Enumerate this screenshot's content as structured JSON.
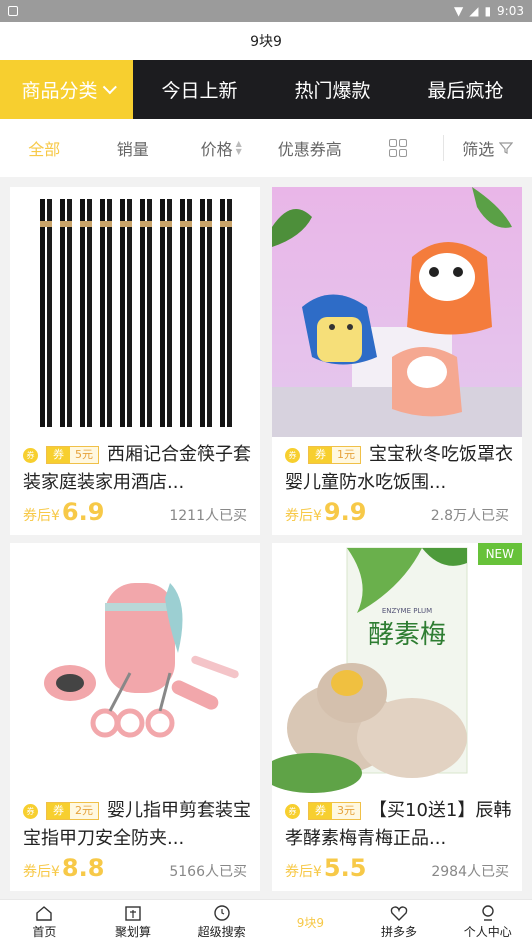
{
  "status": {
    "time": "9:03"
  },
  "header": {
    "title": "9块9"
  },
  "tabs": [
    {
      "label": "商品分类"
    },
    {
      "label": "今日上新"
    },
    {
      "label": "热门爆款"
    },
    {
      "label": "最后疯抢"
    }
  ],
  "sort": {
    "all": "全部",
    "sales": "销量",
    "price": "价格",
    "coupon": "优惠券高",
    "filter": "筛选"
  },
  "products": [
    {
      "coupon": "5元",
      "coupon_tag": "券",
      "title": "西厢记合金筷子套装家庭装家用酒店...",
      "price_label": "券后¥",
      "price": "6.9",
      "sold": "1211人已买"
    },
    {
      "coupon": "1元",
      "coupon_tag": "券",
      "title": "宝宝秋冬吃饭罩衣婴儿童防水吃饭围...",
      "price_label": "券后¥",
      "price": "9.9",
      "sold": "2.8万人已买"
    },
    {
      "coupon": "2元",
      "coupon_tag": "券",
      "title": "婴儿指甲剪套装宝宝指甲刀安全防夹...",
      "price_label": "券后¥",
      "price": "8.8",
      "sold": "5166人已买"
    },
    {
      "coupon": "3元",
      "coupon_tag": "券",
      "title": "【买10送1】辰韩孝酵素梅青梅正品...",
      "price_label": "券后¥",
      "price": "5.5",
      "sold": "2984人已买",
      "badge": "NEW",
      "pack_title": "酵素梅",
      "pack_en": "ENZYME PLUM"
    }
  ],
  "nav": [
    {
      "label": "首页"
    },
    {
      "label": "聚划算"
    },
    {
      "label": "超级搜索"
    },
    {
      "label": "9块9"
    },
    {
      "label": "拼多多"
    },
    {
      "label": "个人中心"
    }
  ],
  "colors": {
    "accent": "#f7cf2f",
    "dark": "#1c1c1f",
    "new": "#67c23a"
  }
}
